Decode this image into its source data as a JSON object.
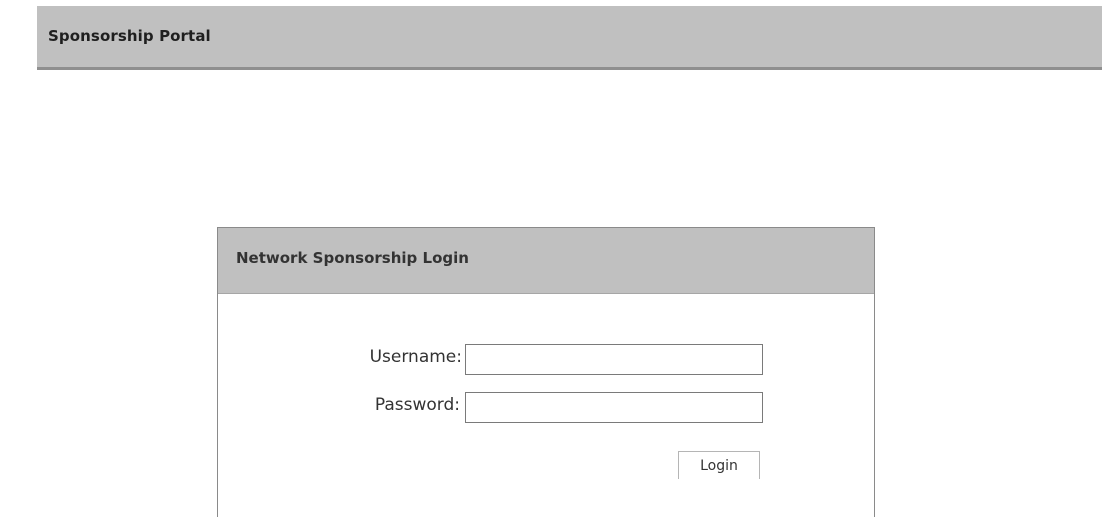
{
  "header": {
    "title": "Sponsorship Portal"
  },
  "login_panel": {
    "title": "Network Sponsorship Login",
    "username_label": "Username:",
    "username_value": "",
    "password_label": "Password:",
    "password_value": "",
    "login_button_label": "Login"
  },
  "colors": {
    "header_bg": "#c0c0c0",
    "header_border": "#8f8f8f",
    "panel_border": "#8a8a8a",
    "text": "#333333"
  }
}
